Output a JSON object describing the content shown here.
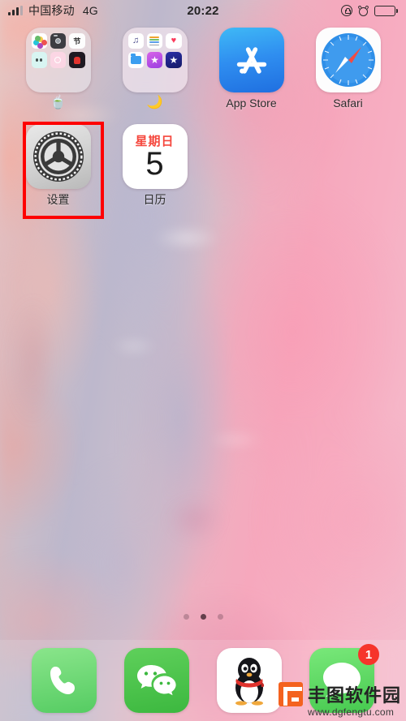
{
  "statusbar": {
    "carrier": "中国移动",
    "network": "4G",
    "time": "20:22",
    "signal_icon": "signal-bars-icon",
    "rotation_lock_icon": "rotation-lock-icon",
    "alarm_icon": "alarm-clock-icon",
    "battery_icon": "battery-full-icon"
  },
  "home": {
    "row1": [
      {
        "type": "folder",
        "name": "folder-1",
        "label": "🍵",
        "minis": [
          "photos",
          "camera",
          "节",
          "teal-app",
          "pink-app",
          "dark-red-app"
        ]
      },
      {
        "type": "folder",
        "name": "folder-2",
        "label": "🌙",
        "minis": [
          "music",
          "reminders",
          "health",
          "files",
          "itunes-store",
          "app-store-dark"
        ]
      },
      {
        "type": "app",
        "name": "app-store",
        "label": "App Store",
        "icon": "app-store-icon"
      },
      {
        "type": "app",
        "name": "safari",
        "label": "Safari",
        "icon": "safari-compass-icon"
      }
    ],
    "row2": [
      {
        "type": "app",
        "name": "settings",
        "label": "设置",
        "icon": "settings-gear-icon",
        "highlighted": true
      },
      {
        "type": "app",
        "name": "calendar",
        "label": "日历",
        "icon": "calendar-icon",
        "weekday": "星期日",
        "day": "5"
      }
    ]
  },
  "highlight": {
    "color": "#fe0000",
    "target": "settings"
  },
  "pagedots": {
    "count": 3,
    "active_index": 1
  },
  "dock": [
    {
      "name": "phone",
      "icon": "phone-handset-icon",
      "badge": null
    },
    {
      "name": "wechat",
      "icon": "wechat-bubbles-icon",
      "badge": null
    },
    {
      "name": "qq",
      "icon": "qq-penguin-icon",
      "badge": null
    },
    {
      "name": "messages",
      "icon": "messages-bubble-icon",
      "badge": "1"
    }
  ],
  "watermark": {
    "brand": "丰图软件园",
    "url": "www.dgfengtu.com",
    "logo_icon": "fengtu-f-logo-icon",
    "color": "#f4621f"
  }
}
